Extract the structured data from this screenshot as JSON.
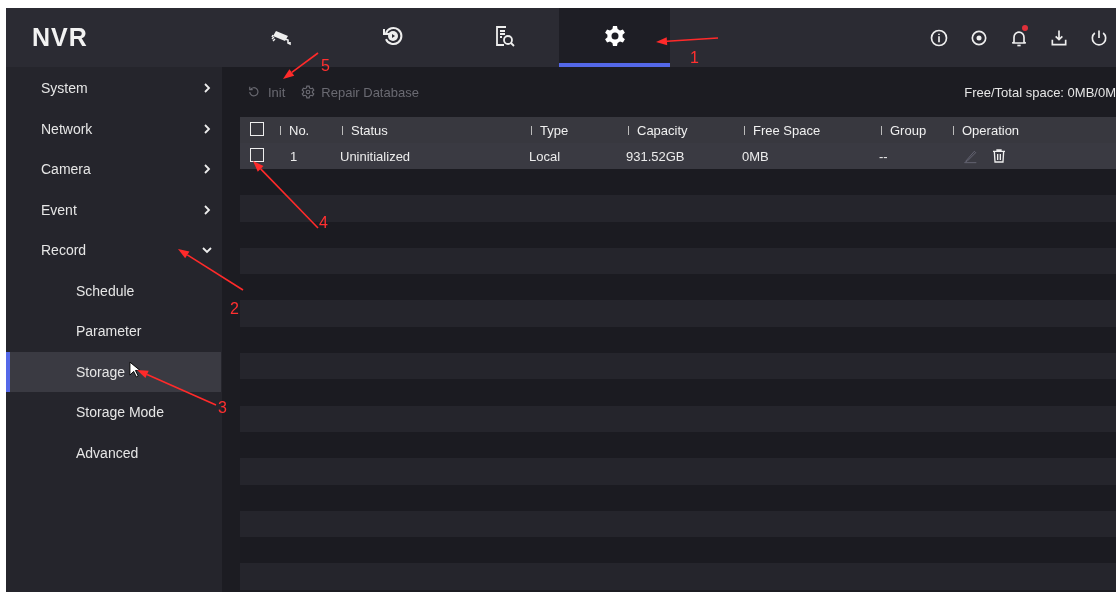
{
  "header": {
    "logo": "NVR",
    "tabs": [
      {
        "kind": "camera",
        "selected": false
      },
      {
        "kind": "playback",
        "selected": false
      },
      {
        "kind": "search",
        "selected": false
      },
      {
        "kind": "settings",
        "selected": true
      }
    ],
    "actions": [
      {
        "kind": "info"
      },
      {
        "kind": "target"
      },
      {
        "kind": "bell",
        "alert": true
      },
      {
        "kind": "download"
      },
      {
        "kind": "power"
      }
    ]
  },
  "sidebar": {
    "items": [
      {
        "label": "System",
        "expanded": false,
        "selected": false
      },
      {
        "label": "Network",
        "expanded": false,
        "selected": false
      },
      {
        "label": "Camera",
        "expanded": false,
        "selected": false
      },
      {
        "label": "Event",
        "expanded": false,
        "selected": false
      },
      {
        "label": "Record",
        "expanded": true,
        "selected": false,
        "children": [
          {
            "label": "Schedule",
            "selected": false
          },
          {
            "label": "Parameter",
            "selected": false
          },
          {
            "label": "Storage",
            "selected": true
          },
          {
            "label": "Storage Mode",
            "selected": false
          },
          {
            "label": "Advanced",
            "selected": false
          }
        ]
      }
    ]
  },
  "toolbar": {
    "buttons": [
      {
        "kind": "init",
        "label": "Init",
        "disabled": true
      },
      {
        "kind": "repair",
        "label": "Repair Database",
        "disabled": true
      }
    ],
    "space": "Free/Total space: 0MB/0M"
  },
  "table": {
    "columns": [
      "No.",
      "Status",
      "Type",
      "Capacity",
      "Free Space",
      "Group",
      "Operation"
    ],
    "all_checked": false,
    "rows": [
      {
        "checked": false,
        "cells": [
          "1",
          "Uninitialized",
          "Local",
          "931.52GB",
          "0MB",
          "--"
        ],
        "edit_disabled": true
      }
    ]
  },
  "annotations": [
    {
      "label": "1"
    },
    {
      "label": "2"
    },
    {
      "label": "3"
    },
    {
      "label": "4"
    },
    {
      "label": "5"
    }
  ]
}
